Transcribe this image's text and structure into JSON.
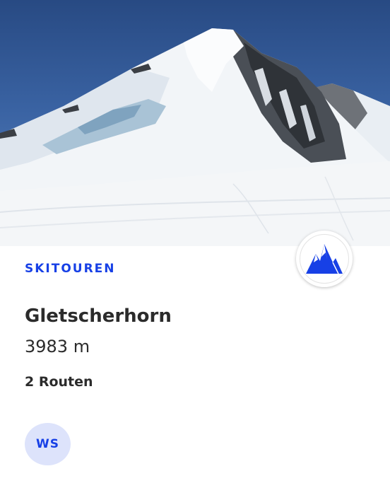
{
  "card": {
    "category": "SKITOUREN",
    "title": "Gletscherhorn",
    "elevation": "3983 m",
    "routes": "2 Routen",
    "difficulty": "WS"
  },
  "hero": {
    "subject": "snow-covered-mountain-peak"
  },
  "badge": {
    "icon": "mountain-icon"
  },
  "colors": {
    "accent": "#1740e6",
    "difficulty_bg": "#dde3fb",
    "text": "#2b2b2b"
  }
}
